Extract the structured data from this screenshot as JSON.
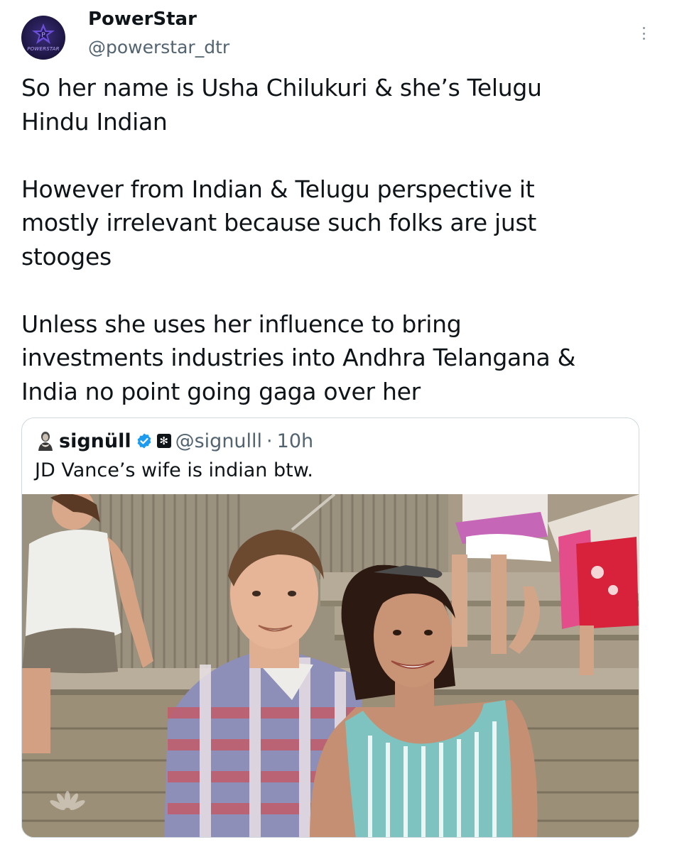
{
  "tweet": {
    "author": {
      "display_name": "PowerStar",
      "handle": "@powerstar_dtr",
      "avatar_label": "POWERSTAR"
    },
    "text": "So her name is Usha Chilukuri & she’s Telugu\nHindu Indian\n\nHowever from Indian & Telugu perspective it\nmostly irrelevant because such folks are just\nstooges\n\nUnless she uses her influence to bring\ninvestments industries into Andhra Telangana &\nIndia no point going gaga over her",
    "menu_icon": "more-vertical-icon"
  },
  "quoted_tweet": {
    "author": {
      "display_name": "signüll",
      "handle": "@signulll",
      "separator": "·",
      "time_ago": "10h",
      "verified": true,
      "verified_color": "#1d9bf0"
    },
    "text": "JD Vance’s wife is indian btw.",
    "photo_description_icon": "photo"
  },
  "colors": {
    "text_primary": "#0f1419",
    "text_secondary": "#536471",
    "border": "#cfd9de",
    "accent": "#1d9bf0"
  }
}
